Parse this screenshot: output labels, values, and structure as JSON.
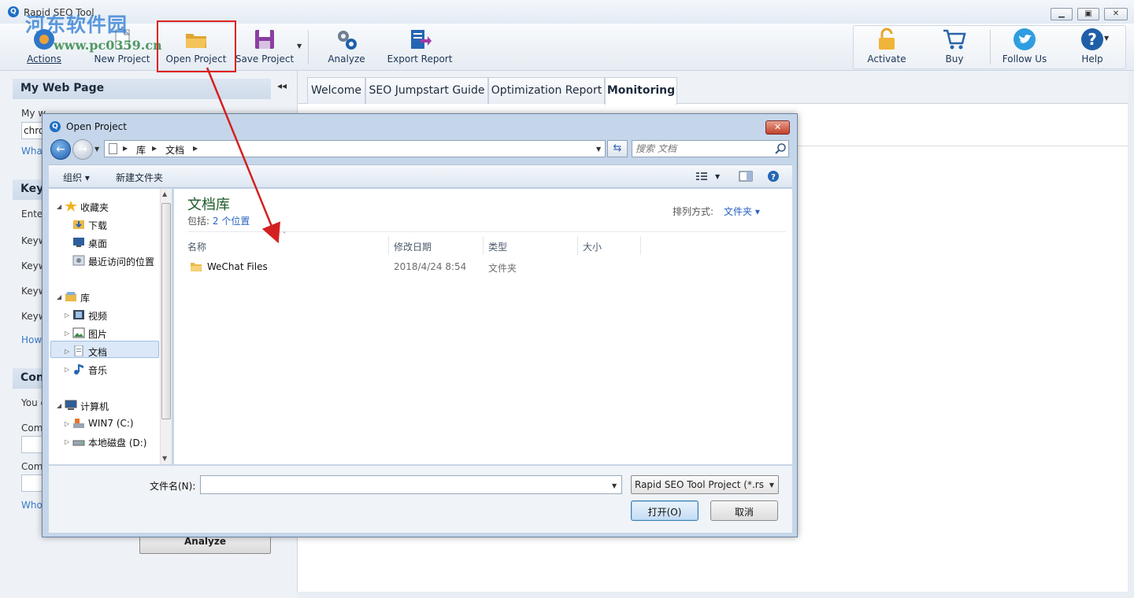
{
  "window": {
    "title": "Rapid SEO Tool"
  },
  "watermark": {
    "text": "河东软件园",
    "url": "www.pc0359.cn"
  },
  "ribbon": {
    "actions": "Actions",
    "new_project": "New Project",
    "open_project": "Open Project",
    "save_project": "Save Project",
    "analyze": "Analyze",
    "export_report": "Export Report",
    "activate": "Activate",
    "buy": "Buy",
    "follow_us": "Follow Us",
    "help": "Help"
  },
  "left_panel": {
    "section1_title": "My Web Page",
    "url_label": "My w",
    "url_value": "chro",
    "url_link": "What",
    "section2_title": "Key",
    "enter_label": "Enter",
    "keyword_labels": [
      "Keyw",
      "Keyw",
      "Keyw",
      "Keyw"
    ],
    "how_link": "How",
    "section3_title": "Con",
    "you_label": "You c",
    "com_label1": "Com",
    "com_label2": "Com",
    "who_link": "Who",
    "analyze_button": "Analyze"
  },
  "tabs": [
    {
      "label": "Welcome"
    },
    {
      "label": "SEO Jumpstart Guide"
    },
    {
      "label": "Optimization Report"
    },
    {
      "label": "Monitoring"
    }
  ],
  "dialog": {
    "title": "Open Project",
    "breadcrumb": [
      "库",
      "文档"
    ],
    "search_placeholder": "搜索 文档",
    "organize": "组织",
    "new_folder": "新建文件夹",
    "nav": {
      "favorites": "收藏夹",
      "downloads": "下载",
      "desktop": "桌面",
      "recent": "最近访问的位置",
      "libraries": "库",
      "videos": "视频",
      "pictures": "图片",
      "documents": "文档",
      "music": "音乐",
      "computer": "计算机",
      "drive_c": "WIN7 (C:)",
      "drive_d": "本地磁盘 (D:)"
    },
    "library_title": "文档库",
    "includes_label": "包括:",
    "includes_link": "2 个位置",
    "sort_label": "排列方式:",
    "sort_value": "文件夹",
    "columns": {
      "name": "名称",
      "date": "修改日期",
      "type": "类型",
      "size": "大小"
    },
    "files": [
      {
        "name": "WeChat Files",
        "date": "2018/4/24 8:54",
        "type": "文件夹",
        "size": ""
      }
    ],
    "filename_label": "文件名(N):",
    "filename_value": "",
    "filetype": "Rapid SEO Tool Project (*.rs",
    "open_button": "打开(O)",
    "cancel_button": "取消"
  },
  "colors": {
    "highlight": "#e02020",
    "accent": "#1f6fc3",
    "link": "#2a63c2",
    "library_title": "#1e5a2a"
  }
}
